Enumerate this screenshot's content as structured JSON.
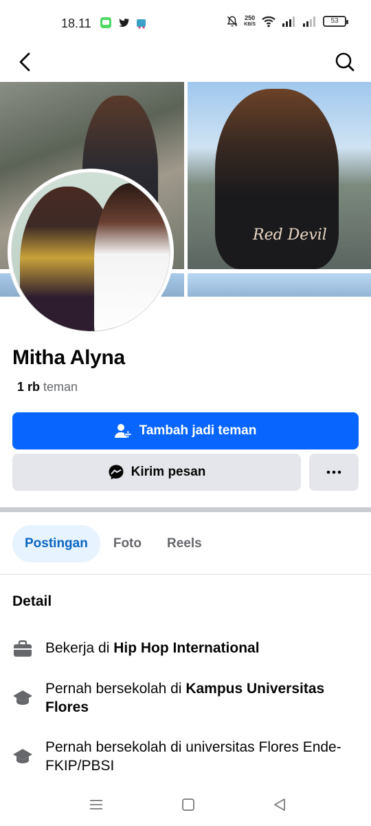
{
  "status_bar": {
    "time": "18.11",
    "net_speed_value": "250",
    "net_speed_unit": "KB/S",
    "battery": "53"
  },
  "top_bar": {
    "back_icon": "chevron-left-icon",
    "search_icon": "search-icon"
  },
  "cover": {
    "shirt_text": "Red Devil"
  },
  "profile": {
    "name": "Mitha Alyna",
    "friends_count": "1 rb",
    "friends_label": "teman"
  },
  "actions": {
    "add_friend_label": "Tambah jadi teman",
    "message_label": "Kirim pesan",
    "more_icon": "more-horizontal-icon",
    "accent_color": "#0866ff"
  },
  "tabs": [
    {
      "label": "Postingan",
      "active": true
    },
    {
      "label": "Foto",
      "active": false
    },
    {
      "label": "Reels",
      "active": false
    }
  ],
  "details": {
    "title": "Detail",
    "items": [
      {
        "icon": "briefcase-icon",
        "prefix": "Bekerja di ",
        "bold": "Hip Hop International"
      },
      {
        "icon": "graduation-cap-icon",
        "prefix": "Pernah bersekolah di ",
        "bold": "Kampus Universitas Flores"
      },
      {
        "icon": "graduation-cap-icon",
        "prefix": "Pernah bersekolah di universitas Flores Ende-FKIP/PBSI",
        "bold": ""
      }
    ]
  },
  "nav_bar": {
    "menu_icon": "menu-icon",
    "home_icon": "home-square-icon",
    "back_icon": "back-triangle-icon"
  }
}
